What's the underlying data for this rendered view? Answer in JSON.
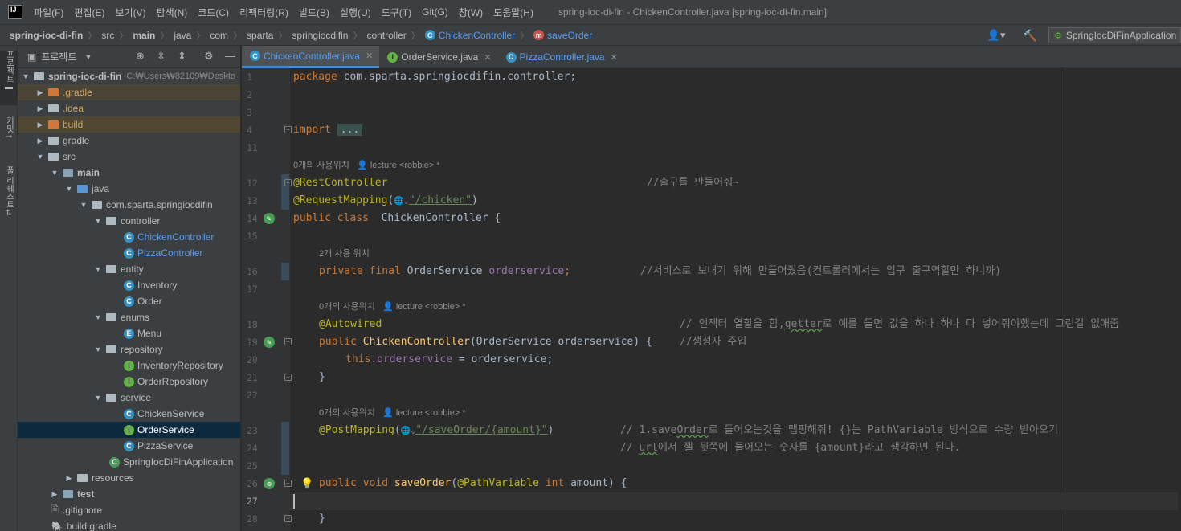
{
  "menubar": {
    "logo": "IJ",
    "items": [
      "파일(F)",
      "편집(E)",
      "보기(V)",
      "탐색(N)",
      "코드(C)",
      "리팩터링(R)",
      "빌드(B)",
      "실행(U)",
      "도구(T)",
      "Git(G)",
      "창(W)",
      "도움말(H)"
    ],
    "title": "spring-ioc-di-fin - ChickenController.java [spring-ioc-di-fin.main]"
  },
  "breadcrumb": {
    "items": [
      "spring-ioc-di-fin",
      "src",
      "main",
      "java",
      "com",
      "sparta",
      "springiocdifin",
      "controller",
      "ChickenController",
      "saveOrder"
    ]
  },
  "toolbar": {
    "run_config": "SpringIocDiFinApplication"
  },
  "tool_strip": {
    "project": "프로젝트",
    "commit": "커밋",
    "pull_requests": "풀 리퀘스트"
  },
  "project_panel": {
    "title": "프로젝트",
    "tree": [
      {
        "label": "spring-ioc-di-fin",
        "path": "C:₩Users₩82109₩Deskto",
        "depth": 0,
        "kind": "project"
      },
      {
        "label": ".gradle",
        "depth": 1,
        "kind": "folder-orange"
      },
      {
        "label": ".idea",
        "depth": 1,
        "kind": "folder"
      },
      {
        "label": "build",
        "depth": 1,
        "kind": "folder-orange"
      },
      {
        "label": "gradle",
        "depth": 1,
        "kind": "folder"
      },
      {
        "label": "src",
        "depth": 1,
        "kind": "folder"
      },
      {
        "label": "main",
        "depth": 2,
        "kind": "folder"
      },
      {
        "label": "java",
        "depth": 3,
        "kind": "folder-blue"
      },
      {
        "label": "com.sparta.springiocdifin",
        "depth": 4,
        "kind": "package"
      },
      {
        "label": "controller",
        "depth": 5,
        "kind": "package"
      },
      {
        "label": "ChickenController",
        "depth": 6,
        "kind": "class"
      },
      {
        "label": "PizzaController",
        "depth": 6,
        "kind": "class"
      },
      {
        "label": "entity",
        "depth": 5,
        "kind": "package"
      },
      {
        "label": "Inventory",
        "depth": 6,
        "kind": "class"
      },
      {
        "label": "Order",
        "depth": 6,
        "kind": "class"
      },
      {
        "label": "enums",
        "depth": 5,
        "kind": "package"
      },
      {
        "label": "Menu",
        "depth": 6,
        "kind": "enum"
      },
      {
        "label": "repository",
        "depth": 5,
        "kind": "package"
      },
      {
        "label": "InventoryRepository",
        "depth": 6,
        "kind": "interface"
      },
      {
        "label": "OrderRepository",
        "depth": 6,
        "kind": "interface"
      },
      {
        "label": "service",
        "depth": 5,
        "kind": "package"
      },
      {
        "label": "ChickenService",
        "depth": 6,
        "kind": "class"
      },
      {
        "label": "OrderService",
        "depth": 6,
        "kind": "interface"
      },
      {
        "label": "PizzaService",
        "depth": 6,
        "kind": "class"
      },
      {
        "label": "SpringIocDiFinApplication",
        "depth": 5,
        "kind": "app"
      },
      {
        "label": "resources",
        "depth": 3,
        "kind": "folder"
      },
      {
        "label": "test",
        "depth": 2,
        "kind": "folder"
      },
      {
        "label": ".gitignore",
        "depth": 1,
        "kind": "file"
      },
      {
        "label": "build.gradle",
        "depth": 1,
        "kind": "file"
      }
    ]
  },
  "tabs": [
    {
      "label": "ChickenController.java",
      "icon": "C",
      "active": true
    },
    {
      "label": "OrderService.java",
      "icon": "I",
      "active": false
    },
    {
      "label": "PizzaController.java",
      "icon": "C",
      "active": false
    }
  ],
  "editor": {
    "line_numbers": [
      "1",
      "2",
      "3",
      "4",
      "11",
      "12",
      "13",
      "14",
      "15",
      "16",
      "17",
      "18",
      "19",
      "20",
      "21",
      "22",
      "23",
      "24",
      "25",
      "26",
      "27",
      "28"
    ],
    "hints": {
      "usage_0a": "0개의 사용위치",
      "author_a": "lecture <robbie> *",
      "usage_2": "2개 사용 위치",
      "usage_0b": "0개의 사용위치",
      "author_b": "lecture <robbie> *",
      "usage_0c": "0개의 사용위치",
      "author_c": "lecture <robbie> *"
    },
    "code": {
      "l1_kw": "package",
      "l1_rest": " com.sparta.springiocdifin.controller;",
      "l4_kw": "import",
      "l4_fold": "...",
      "l12_ann": "@RestController",
      "l12_cmt": "//출구를 만들어줘~",
      "l13_ann": "@RequestMapping",
      "l13_open": "(",
      "l13_globe": "🌐⌄",
      "l13_str": "\"/chicken\"",
      "l13_close": ")",
      "l14_kw": "public class",
      "l14_rest": "  ChickenController {",
      "l16_kw": "private final",
      "l16_type": " OrderService ",
      "l16_fld": "orderservice",
      "l16_semi": ";",
      "l16_cmt": "//서비스로 보내기 위해 만들어줬음(컨트롤러에서는 입구 출구역할만 하니까)",
      "l18_ann": "@Autowired",
      "l18_cmt_a": "// 인젝터 열할을 함,",
      "l18_cmt_getter": "getter",
      "l18_cmt_b": "로 예를 들면 값을 하나 하나 다 넣어줘야했는데 그런걸 없애줌",
      "l19_kw": "public",
      "l19_fn": " ChickenController",
      "l19_rest": "(OrderService orderservice) {",
      "l19_cmt": "//생성자 주입",
      "l20_kw": "this",
      "l20_dot": ".",
      "l20_fld": "orderservice",
      "l20_rest": " = orderservice;",
      "l21": "}",
      "l23_ann": "@PostMapping",
      "l23_open": "(",
      "l23_globe": "🌐⌄",
      "l23_str": "\"/saveOrder/{amount}\"",
      "l23_close": ")",
      "l23_cmt_a": "// 1.save",
      "l23_cmt_order": "Order",
      "l23_cmt_b": "로 들어오는것을 맵핑해줘! {}는 PathVariable 방식으로 수량 받아오기",
      "l24_cmt_a": "// ",
      "l24_cmt_url": "url",
      "l24_cmt_b": "에서 젤 뒷쪽에 들어오는 숫자를 {amount}라고 생각하면 된다.",
      "l26_kw": "public void",
      "l26_fn": " saveOrder",
      "l26_open": "(",
      "l26_ann": "@PathVariable",
      "l26_int": " int",
      "l26_rest": " amount) {",
      "l28": "}"
    }
  }
}
